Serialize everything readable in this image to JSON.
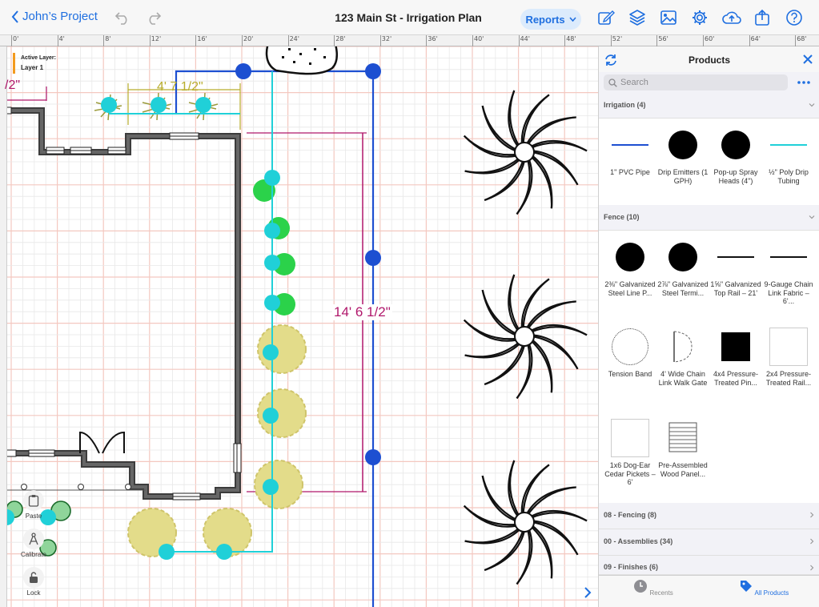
{
  "toolbar": {
    "back_label": "John’s Project",
    "title": "123 Main St - Irrigation Plan",
    "reports_label": "Reports"
  },
  "ruler": {
    "ticks": [
      "0'",
      "4'",
      "8'",
      "12'",
      "16'",
      "20'",
      "24'",
      "28'",
      "32'",
      "36'",
      "40'",
      "44'",
      "48'",
      "52'",
      "56'",
      "60'",
      "64'",
      "68'"
    ]
  },
  "canvas": {
    "active_layer_title": "Active Layer:",
    "active_layer_name": "Layer 1",
    "dim_horizontal": "4' 7 1/2\"",
    "dim_vertical": "14' 6 1/2\"",
    "dim_left_partial": "/2\""
  },
  "tools": {
    "paste": "Paste",
    "calibrate": "Calibrate",
    "lock": "Lock"
  },
  "panel": {
    "title": "Products",
    "search_placeholder": "Search",
    "sections": [
      {
        "label": "Irrigation (4)",
        "expanded": true
      },
      {
        "label": "Fence (10)",
        "expanded": true
      },
      {
        "label": "08 - Fencing (8)",
        "expanded": false
      },
      {
        "label": "00 - Assemblies (34)",
        "expanded": false
      },
      {
        "label": "09 - Finishes (6)",
        "expanded": false
      }
    ],
    "irrigation_items": [
      {
        "label": "1\" PVC Pipe"
      },
      {
        "label": "Drip Emitters (1 GPH)"
      },
      {
        "label": "Pop-up Spray Heads (4\")"
      },
      {
        "label": "½\" Poly Drip Tubing"
      }
    ],
    "fence_items": [
      {
        "label": "2⅜\" Galvanized Steel Line P..."
      },
      {
        "label": "2⅞\" Galvanized Steel Termi..."
      },
      {
        "label": "1⅝\" Galvanized Top Rail – 21'"
      },
      {
        "label": "9-Gauge Chain Link Fabric – 6'..."
      },
      {
        "label": "Tension Band"
      },
      {
        "label": "4' Wide Chain Link Walk Gate"
      },
      {
        "label": "4x4 Pressure-Treated Pin..."
      },
      {
        "label": "2x4 Pressure-Treated Rail..."
      },
      {
        "label": "1x6 Dog-Ear Cedar Pickets – 6'"
      },
      {
        "label": "Pre-Assembled Wood Panel..."
      }
    ],
    "tabs": [
      {
        "label": "Recents",
        "active": false
      },
      {
        "label": "All Products",
        "active": true
      }
    ]
  },
  "colors": {
    "accent": "#1f6fe0",
    "pipe": "#1d4fd1",
    "drip_tubing": "#20d0d8",
    "dimension": "#b0176b",
    "wall": "#4a4a4a",
    "active_layer": "#f39a1e"
  }
}
